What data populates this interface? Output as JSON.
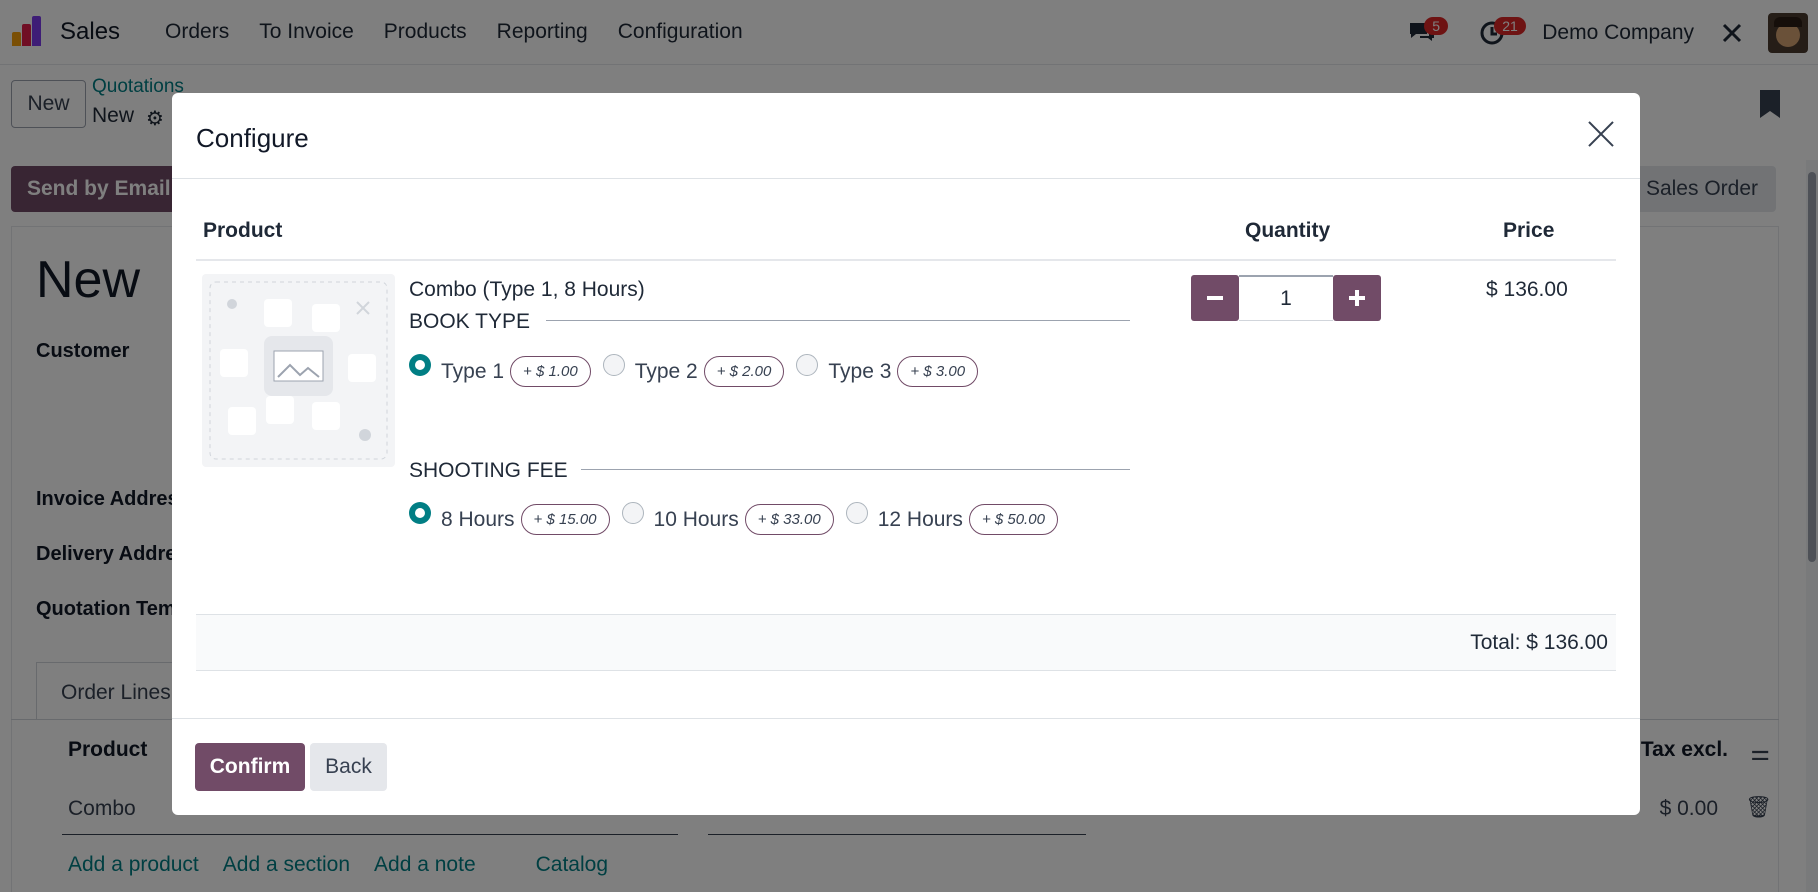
{
  "app": {
    "name": "Sales",
    "menu": [
      "Orders",
      "To Invoice",
      "Products",
      "Reporting",
      "Configuration"
    ],
    "messages_badge": "5",
    "activities_badge": "21",
    "company": "Demo Company"
  },
  "control": {
    "new_label": "New",
    "breadcrumb_parent": "Quotations",
    "breadcrumb_current": "New"
  },
  "actions": {
    "send_by_email": "Send by Email",
    "sales_order": "Sales Order"
  },
  "form": {
    "title": "New",
    "customer_label": "Customer",
    "invoice_address_label": "Invoice Address",
    "delivery_address_label": "Delivery Address",
    "quotation_template_label": "Quotation Template"
  },
  "order_lines": {
    "tab_label": "Order Lines",
    "col_product": "Product",
    "col_tax_excl": "Tax excl.",
    "row_product": "Combo",
    "row_amount": "$ 0.00",
    "links": [
      "Add a product",
      "Add a section",
      "Add a note",
      "Catalog"
    ]
  },
  "modal": {
    "title": "Configure",
    "col_product": "Product",
    "col_quantity": "Quantity",
    "col_price": "Price",
    "product_name": "Combo (Type 1, 8 Hours)",
    "attributes": [
      {
        "name": "BOOK TYPE",
        "options": [
          {
            "label": "Type 1",
            "extra": "+ $ 1.00",
            "selected": true
          },
          {
            "label": "Type 2",
            "extra": "+ $ 2.00",
            "selected": false
          },
          {
            "label": "Type 3",
            "extra": "+ $ 3.00",
            "selected": false
          }
        ]
      },
      {
        "name": "SHOOTING FEE",
        "options": [
          {
            "label": "8 Hours",
            "extra": "+ $ 15.00",
            "selected": true
          },
          {
            "label": "10 Hours",
            "extra": "+ $ 33.00",
            "selected": false
          },
          {
            "label": "12 Hours",
            "extra": "+ $ 50.00",
            "selected": false
          }
        ]
      }
    ],
    "quantity": "1",
    "price": "$ 136.00",
    "total": "Total: $ 136.00",
    "confirm_label": "Confirm",
    "back_label": "Back"
  },
  "colors": {
    "brand": "#714b67",
    "accent": "#017e84",
    "badge": "#dc2626"
  }
}
